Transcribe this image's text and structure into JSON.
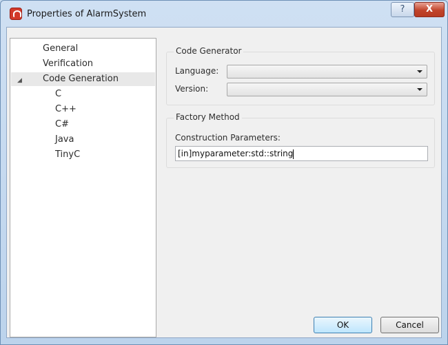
{
  "window": {
    "title": "Properties of AlarmSystem",
    "help_label": "?",
    "close_label": "X"
  },
  "tree": {
    "items": [
      {
        "label": "General"
      },
      {
        "label": "Verification"
      },
      {
        "label": "Code Generation",
        "expanded": true,
        "selected": true
      },
      {
        "label": "C"
      },
      {
        "label": "C++"
      },
      {
        "label": "C#"
      },
      {
        "label": "Java"
      },
      {
        "label": "TinyC"
      }
    ]
  },
  "code_generator": {
    "title": "Code Generator",
    "language_label": "Language:",
    "language_value": "",
    "version_label": "Version:",
    "version_value": ""
  },
  "factory_method": {
    "title": "Factory Method",
    "params_label": "Construction Parameters:",
    "params_value": "[in]myparameter:std::string"
  },
  "buttons": {
    "ok": "OK",
    "cancel": "Cancel"
  }
}
